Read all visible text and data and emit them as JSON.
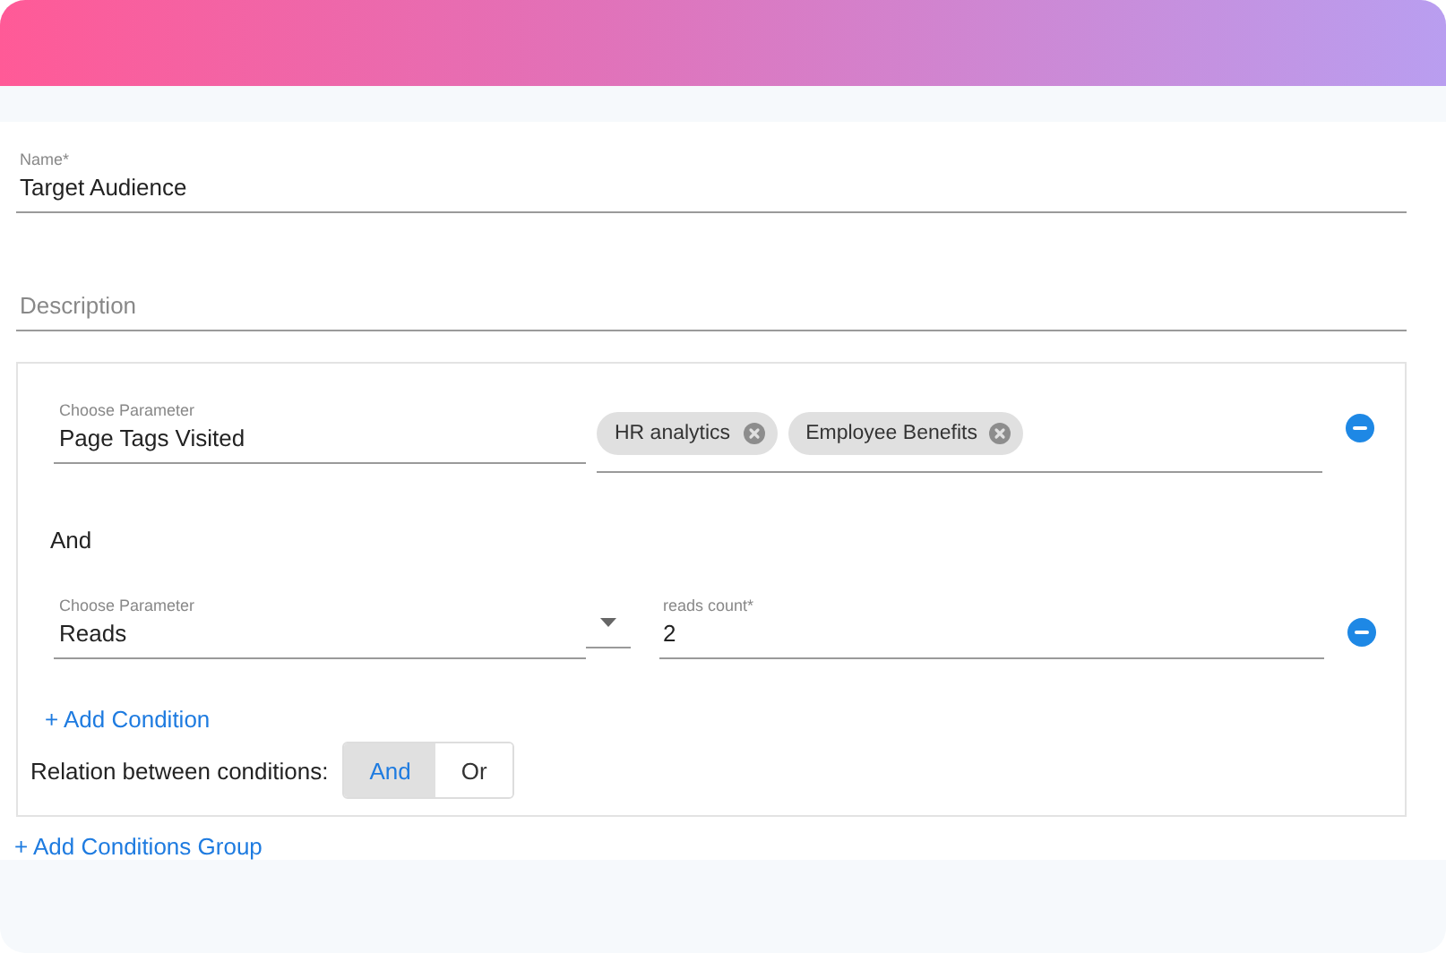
{
  "name_field": {
    "label": "Name*",
    "value": "Target Audience"
  },
  "description_field": {
    "placeholder": "Description"
  },
  "conditions_group": {
    "conditions": [
      {
        "kind": "tags",
        "parameter_label": "Choose Parameter",
        "parameter_value": "Page Tags Visited",
        "tags": [
          "HR analytics",
          "Employee Benefits"
        ]
      },
      {
        "kind": "count",
        "parameter_label": "Choose Parameter",
        "parameter_value": "Reads",
        "count_label": "reads count*",
        "count_value": "2"
      }
    ],
    "connector": "And",
    "add_condition": "+ Add Condition",
    "relation_label": "Relation between conditions:",
    "relation_options": [
      {
        "label": "And",
        "selected": true
      },
      {
        "label": "Or",
        "selected": false
      }
    ]
  },
  "add_group": "+ Add Conditions Group"
}
